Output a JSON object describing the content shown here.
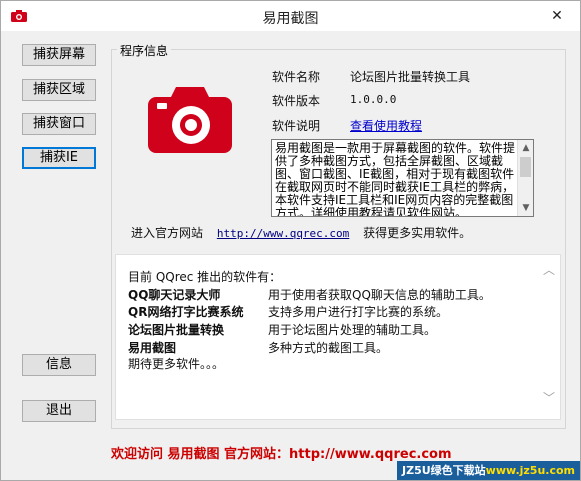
{
  "window": {
    "title": "易用截图",
    "close_glyph": "✕",
    "app_icon": "camera-icon"
  },
  "left_buttons": {
    "capture_screen": "捕获屏幕",
    "capture_region": "捕获区域",
    "capture_window": "捕获窗口",
    "capture_ie": "捕获IE",
    "info": "信息",
    "exit": "退出"
  },
  "program_info": {
    "group_label": "程序信息",
    "logo_icon": "camera-icon",
    "logo_color": "#d0021b",
    "name_label": "软件名称",
    "name_value": "论坛图片批量转换工具",
    "version_label": "软件版本",
    "version_value": "1.0.0.0",
    "manual_label": "软件说明",
    "manual_link": "查看使用教程",
    "description": "易用截图是一款用于屏幕截图的软件。软件提供了多种截图方式，包括全屏截图、区域截图、窗口截图、IE截图，相对于现有截图软件在截取网页时不能同时截获IE工具栏的弊病，本软件支持IE工具栏和IE网页内容的完整截图方式。详细使用教程请见软件网站。"
  },
  "website": {
    "prefix": "进入官方网站",
    "url": "http://www.qqrec.com",
    "suffix": "获得更多实用软件。"
  },
  "products": {
    "intro": "目前 QQrec 推出的软件有：",
    "items": [
      {
        "name": "QQ聊天记录大师",
        "desc": "用于使用者获取QQ聊天信息的辅助工具。"
      },
      {
        "name": "QR网络打字比赛系统",
        "desc": "支持多用户进行打字比赛的系统。"
      },
      {
        "name": "论坛图片批量转换",
        "desc": "用于论坛图片处理的辅助工具。"
      },
      {
        "name": "易用截图",
        "desc": "多种方式的截图工具。"
      }
    ],
    "more": "期待更多软件。。。"
  },
  "footer": {
    "text": "欢迎访问 易用截图 官方网站：http://www.qqrec.com",
    "color": "#cc0000"
  },
  "watermark": {
    "brand": "JZ5U绿色下载站",
    "site": "www.jz5u.com"
  }
}
